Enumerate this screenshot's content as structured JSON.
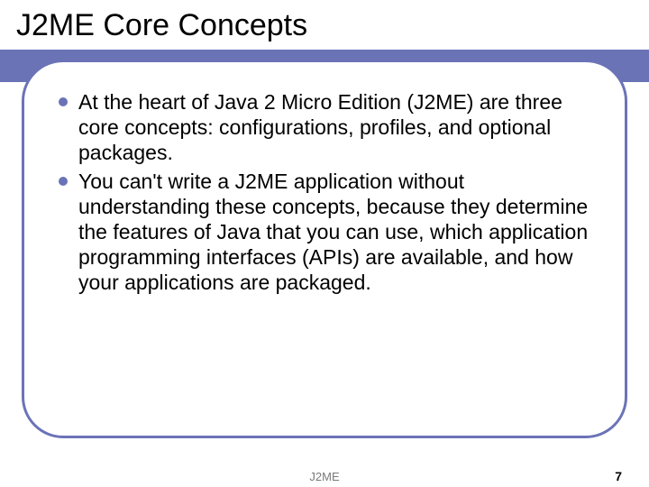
{
  "title": "J2ME Core Concepts",
  "bullets": [
    "At the heart of Java 2 Micro Edition (J2ME) are three core concepts: configurations, profiles, and optional packages.",
    "You can't write a J2ME application without understanding these concepts, because they determine the features of Java that you can use, which application programming interfaces (APIs) are available, and how your applications are packaged."
  ],
  "footer": {
    "label": "J2ME",
    "page": "7"
  },
  "colors": {
    "accent": "#6b73b7"
  }
}
